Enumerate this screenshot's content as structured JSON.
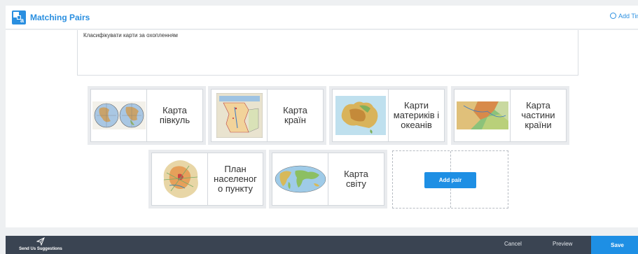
{
  "header": {
    "app_title": "Matching Pairs",
    "add_timer_label": "Add Tim"
  },
  "question": {
    "text": "Класифікувати карти за охопленням"
  },
  "pairs": [
    {
      "image": "hemispheres-map-image",
      "label": "Карта\nпівкуль"
    },
    {
      "image": "countries-map-image",
      "label": "Карта\nкраїн"
    },
    {
      "image": "continents-map-image",
      "label": "Карти\nматериків і\nокеанів"
    },
    {
      "image": "country-part-map-image",
      "label": "Карта\nчастини\nкраїни"
    },
    {
      "image": "settlement-plan-image",
      "label": "План\nнаселеног\nо пункту"
    },
    {
      "image": "world-map-image",
      "label": "Карта\nсвіту"
    }
  ],
  "add_pair": {
    "label": "Add pair"
  },
  "footer": {
    "suggestions_label": "Send Us Suggestions",
    "cancel_label": "Cancel",
    "preview_label": "Preview",
    "save_label": "Save"
  },
  "colors": {
    "accent": "#1e8fe4",
    "footer_bg": "#3a4452",
    "page_bg": "#eef0f2"
  }
}
